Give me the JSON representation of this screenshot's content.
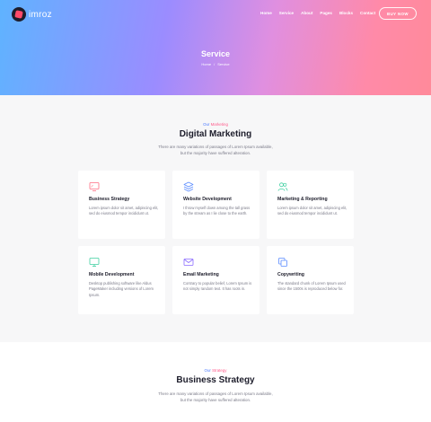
{
  "brand": {
    "name": "imroz"
  },
  "nav": {
    "items": [
      "Home",
      "Service",
      "About",
      "Pages",
      "Blocks",
      "Contact"
    ],
    "cta": "BUY NOW"
  },
  "hero": {
    "title": "Service",
    "breadcrumb": [
      "Home",
      "/",
      "Service"
    ]
  },
  "marketing": {
    "label_part1": "Our",
    "label_part2": "Marketing",
    "title": "Digital Marketing",
    "desc_line1": "There are many variations of passages of Lorem Ipsum available,",
    "desc_line2": "but the majority have suffered alteration.",
    "cards": [
      {
        "icon": "monitor-icon",
        "color": "#ff6b81",
        "title": "Business Strategy",
        "text": "Lorem ipsum dolor sit amet, adipiscing elit, sed do eiusmod tempor incididunt ut."
      },
      {
        "icon": "layers-icon",
        "color": "#5b8cff",
        "title": "Website Development",
        "text": "I throw myself down among the tall grass by the stream as I lie close to the earth."
      },
      {
        "icon": "users-icon",
        "color": "#3ecfa0",
        "title": "Marketing & Reporting",
        "text": "Lorem ipsum dolor sit amet, adipiscing elit, sed do eiusmod tempor incididunt ut."
      },
      {
        "icon": "monitor-icon",
        "color": "#3ecfa0",
        "title": "Mobile Development",
        "text": "Desktop publishing software like Aldus PageMaker including versions of Lorem Ipsum."
      },
      {
        "icon": "mail-icon",
        "color": "#8a6bff",
        "title": "Email Marketing",
        "text": "Contrary to popular belief, Lorem Ipsum is not simply random text. It has roots in."
      },
      {
        "icon": "copy-icon",
        "color": "#5b8cff",
        "title": "Copywriting",
        "text": "The standard chunk of Lorem Ipsum used since the 1500s is reproduced below for."
      }
    ]
  },
  "strategy": {
    "label_part1": "Our",
    "label_part2": "Strategy",
    "title": "Business Strategy",
    "desc_line1": "There are many variations of passages of Lorem Ipsum available,",
    "desc_line2": "but the majority have suffered alteration."
  }
}
